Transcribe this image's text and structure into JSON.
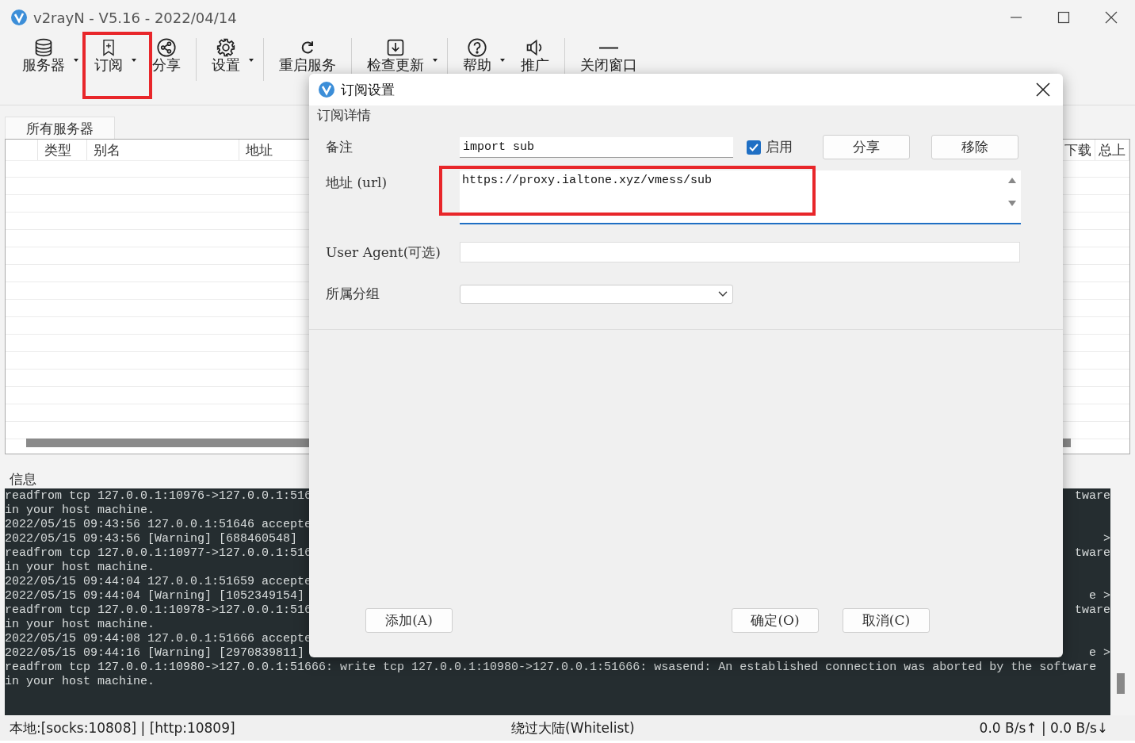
{
  "window": {
    "title": "v2rayN - V5.16 - 2022/04/14"
  },
  "toolbar": [
    {
      "label": "服务器",
      "dropdown": true,
      "highlighted": false,
      "separator": false
    },
    {
      "label": "订阅",
      "dropdown": true,
      "highlighted": true,
      "separator": false
    },
    {
      "label": "分享",
      "dropdown": false,
      "highlighted": false,
      "separator": true
    },
    {
      "label": "设置",
      "dropdown": true,
      "highlighted": false,
      "separator": true
    },
    {
      "label": "重启服务",
      "dropdown": false,
      "highlighted": false,
      "separator": true
    },
    {
      "label": "检查更新",
      "dropdown": true,
      "highlighted": false,
      "separator": true
    },
    {
      "label": "帮助",
      "dropdown": true,
      "highlighted": false,
      "separator": false
    },
    {
      "label": "推广",
      "dropdown": false,
      "highlighted": false,
      "separator": true
    },
    {
      "label": "关闭窗口",
      "dropdown": false,
      "highlighted": false,
      "separator": false
    }
  ],
  "server_tab": {
    "label": "所有服务器",
    "selected": true
  },
  "table": {
    "columns": [
      "类型",
      "别名",
      "地址"
    ],
    "columns_right": [
      "下载",
      "总上"
    ]
  },
  "log": {
    "title": "信息",
    "lines": [
      {
        "left": "readfrom tcp 127.0.0.1:10976->127.0.0.1:516",
        "right": "tware"
      },
      {
        "left": "in your host machine."
      },
      {
        "left": "2022/05/15 09:43:56 127.0.0.1:51646 accepte"
      },
      {
        "left": "2022/05/15 09:43:56 [Warning] [688460548]",
        "right": ">"
      },
      {
        "left": "readfrom tcp 127.0.0.1:10977->127.0.0.1:516",
        "right": "tware"
      },
      {
        "left": "in your host machine."
      },
      {
        "left": "2022/05/15 09:44:04 127.0.0.1:51659 accepte"
      },
      {
        "left": "2022/05/15 09:44:04 [Warning] [1052349154]",
        "right": "e >"
      },
      {
        "left": "readfrom tcp 127.0.0.1:10978->127.0.0.1:516",
        "right": "tware"
      },
      {
        "left": "in your host machine."
      },
      {
        "left": "2022/05/15 09:44:08 127.0.0.1:51666 accepte"
      },
      {
        "left": "2022/05/15 09:44:16 [Warning] [2970839811]",
        "right": "e >"
      },
      {
        "left": "readfrom tcp 127.0.0.1:10980->127.0.0.1:51666: write tcp 127.0.0.1:10980->127.0.0.1:51666: wsasend: An established connection was aborted by the software"
      },
      {
        "left": "in your host machine."
      }
    ]
  },
  "status_bar": {
    "local": "本地:[socks:10808] | [http:10809]",
    "routing": "绕过大陆(Whitelist)",
    "speed": "0.0 B/s↑ | 0.0 B/s↓"
  },
  "dialog": {
    "title": "订阅设置",
    "group": "订阅详情",
    "remarks": {
      "label": "备注",
      "value": "import sub"
    },
    "enabled": {
      "label": "启用",
      "checked": true
    },
    "buttons_top": [
      "分享",
      "移除"
    ],
    "url": {
      "label": "地址 (url)",
      "value": "https://proxy.ialtone.xyz/vmess/sub",
      "highlighted": true
    },
    "user_agent": {
      "label": "User Agent(可选)"
    },
    "group_select": {
      "label": "所属分组"
    },
    "buttons_bottom": [
      "添加(A)",
      "确定(O)",
      "取消(C)"
    ]
  }
}
